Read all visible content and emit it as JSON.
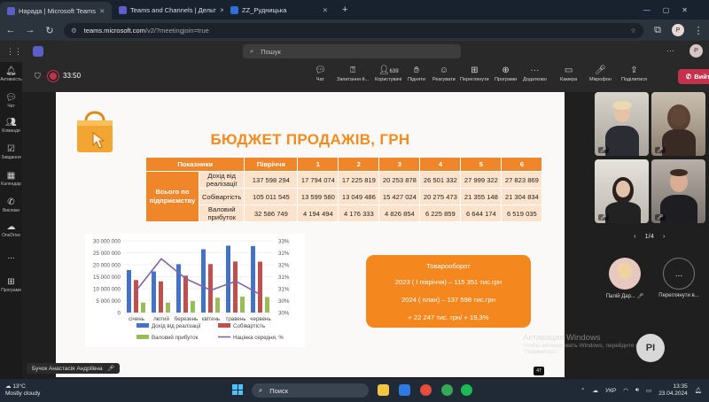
{
  "browser": {
    "tabs": [
      {
        "title": "Нарада | Microsoft Teams",
        "active": true
      },
      {
        "title": "Teams and Channels | Дельт",
        "active": false
      },
      {
        "title": "ZZ_Рудницька",
        "active": false
      }
    ],
    "url_host": "teams.microsoft.com",
    "url_path": "/v2/?meetingjoin=true",
    "profile_initial": "P"
  },
  "teams": {
    "search_placeholder": "Пошук"
  },
  "rail": [
    {
      "icon": "bell-icon",
      "label": "Активність"
    },
    {
      "icon": "chat-icon",
      "label": "Чат"
    },
    {
      "icon": "teams-icon",
      "label": "Команди"
    },
    {
      "icon": "tasks-icon",
      "label": "Завдання"
    },
    {
      "icon": "calendar-icon",
      "label": "Календар"
    },
    {
      "icon": "calls-icon",
      "label": "Виклики"
    },
    {
      "icon": "onedrive-icon",
      "label": "OneDrive"
    },
    {
      "icon": "more-icon",
      "label": "..."
    },
    {
      "icon": "apps-icon",
      "label": "Програми"
    }
  ],
  "meeting": {
    "timer": "33:50",
    "participants_count": "639",
    "tools": [
      {
        "icon": "chat-icon",
        "label": "Чат"
      },
      {
        "icon": "qa-icon",
        "label": "Запитання й..."
      },
      {
        "icon": "people-icon",
        "label": "Користувачі"
      },
      {
        "icon": "hand-icon",
        "label": "Підняти"
      },
      {
        "icon": "react-icon",
        "label": "Реагувати"
      },
      {
        "icon": "view-icon",
        "label": "Переглянути"
      },
      {
        "icon": "apps-icon",
        "label": "Програми"
      },
      {
        "icon": "more-icon",
        "label": "Додатково"
      },
      {
        "icon": "camera-icon",
        "label": "Камера"
      },
      {
        "icon": "mic-icon",
        "label": "Мікрофон"
      },
      {
        "icon": "share-icon",
        "label": "Поділитися"
      }
    ],
    "leave_label": "Вийти",
    "speaker_name": "Бучок Анастасія Андріївна",
    "page_badge": "47",
    "pager": "1/4"
  },
  "slide": {
    "title": "БЮДЖЕТ ПРОДАЖІВ, ГРН",
    "table": {
      "headers": [
        "Показники",
        "Півріччя",
        "1",
        "2",
        "3",
        "4",
        "5",
        "6"
      ],
      "group_label": "Всього по підприємству",
      "rows": [
        {
          "label": "Дохід від реалізації",
          "values": [
            "137 598 294",
            "17 794 074",
            "17 225 819",
            "20 253 878",
            "26 501 332",
            "27 999 322",
            "27 823 869"
          ]
        },
        {
          "label": "Собівартість",
          "values": [
            "105 011 545",
            "13 599 580",
            "13 049 486",
            "15 427 024",
            "20 275 473",
            "21 355 148",
            "21 304 834"
          ]
        },
        {
          "label": "Валовий прибуток",
          "values": [
            "32 586 749",
            "4 194 494",
            "4 176 333",
            "4 826 854",
            "6 225 859",
            "6 644 174",
            "6 519 035"
          ]
        }
      ]
    },
    "info": {
      "title": "Товарооборот",
      "line1": "2023 ( I півріччя) – 115 351 тис.грн",
      "line2": "2024 ( план) – 137 598 тис.грн",
      "line3": "+ 22 247 тис. грн/ + 19,3%"
    }
  },
  "chart_data": {
    "type": "bar",
    "categories": [
      "січень",
      "лютий",
      "березень",
      "квітень",
      "травень",
      "червень"
    ],
    "series": [
      {
        "name": "Дохід від реалізації",
        "type": "bar",
        "axis": "left",
        "color": "#4472c4",
        "values": [
          17794074,
          17225819,
          20253878,
          26501332,
          27999322,
          27823869
        ]
      },
      {
        "name": "Собівартість",
        "type": "bar",
        "axis": "left",
        "color": "#c0504d",
        "values": [
          13599580,
          13049486,
          15427024,
          20275473,
          21355148,
          21304834
        ]
      },
      {
        "name": "Валовий прибуток",
        "type": "bar",
        "axis": "left",
        "color": "#9bbb59",
        "values": [
          4194494,
          4176333,
          4826854,
          6225859,
          6644174,
          6519035
        ]
      },
      {
        "name": "Націнка середня, %",
        "type": "line",
        "axis": "right",
        "color": "#8064a2",
        "values": [
          30.8,
          32.2,
          31.3,
          30.8,
          31.2,
          30.6
        ]
      }
    ],
    "left_ticks": [
      "30 000 000",
      "25 000 000",
      "20 000 000",
      "15 000 000",
      "10 000 000",
      "5 000 000",
      "0"
    ],
    "right_ticks": [
      "33%",
      "32%",
      "32%",
      "31%",
      "31%",
      "30%",
      "30%"
    ],
    "ylim": [
      0,
      30000000
    ],
    "y2lim": [
      29.8,
      33
    ],
    "legend": "bottom"
  },
  "participants": [
    {
      "name": "Палій Дар...",
      "initials": ""
    },
    {
      "name": "Переглянути в...",
      "initials": "..."
    }
  ],
  "watermark": {
    "line1": "Активация Windows",
    "line2": "Чтобы активировать Windows, перейдите в раздел",
    "line3": "\"Параметры\"."
  },
  "pi_initials": "PI",
  "taskbar": {
    "temp": "13°C",
    "weather": "Mostly cloudy",
    "search": "Поиск",
    "lang": "УКР",
    "time": "13:35",
    "date": "23.04.2024"
  }
}
